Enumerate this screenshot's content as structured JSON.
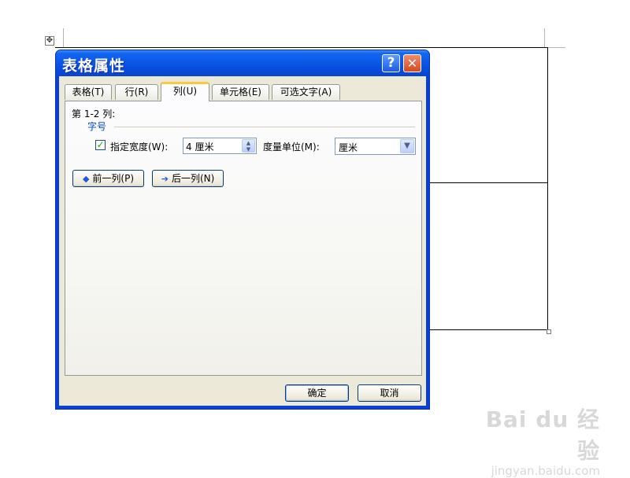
{
  "dialog": {
    "title": "表格属性",
    "help_glyph": "?",
    "close_glyph": "✕"
  },
  "tabs": [
    {
      "label": "表格(T)",
      "active": false
    },
    {
      "label": "行(R)",
      "active": false
    },
    {
      "label": "列(U)",
      "active": true
    },
    {
      "label": "单元格(E)",
      "active": false
    },
    {
      "label": "可选文字(A)",
      "active": false
    }
  ],
  "column": {
    "range_label": "第 1-2 列:",
    "group_label": "字号",
    "specify_width_label": "指定宽度(W):",
    "specify_width_checked": true,
    "width_value": "4 厘米",
    "unit_label": "度量单位(M):",
    "unit_value": "厘米",
    "prev_column_label": "前一列(P)",
    "next_column_label": "后一列(N)"
  },
  "footer": {
    "ok_label": "确定",
    "cancel_label": "取消"
  },
  "watermark": {
    "logo": "Bai du 经验",
    "url": "jingyan.baidu.com"
  },
  "colors": {
    "title_bar": "#0a55e6",
    "group_label": "#0046d5",
    "active_tab_accent": "#ffc83c"
  }
}
